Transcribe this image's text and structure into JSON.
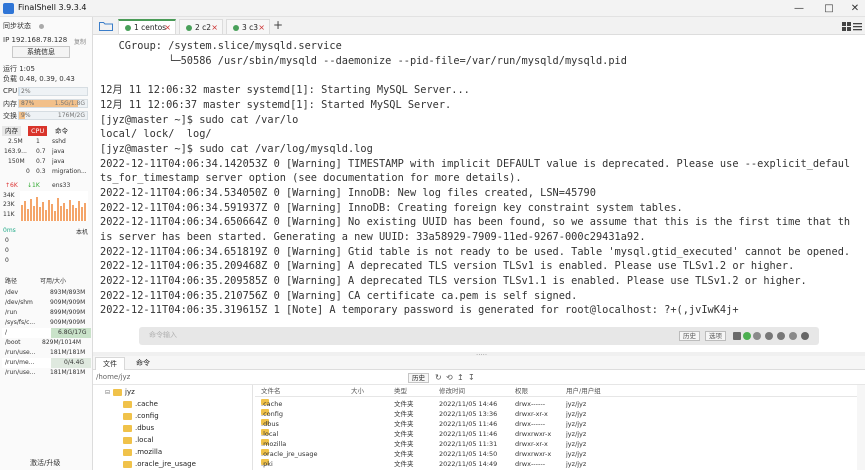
{
  "window": {
    "title": "FinalShell 3.9.3.4",
    "minimize": "—",
    "maximize": "□",
    "close": "✕"
  },
  "sidebar": {
    "sync_status": "同步状态",
    "ip": "IP 192.168.78.128",
    "copy": "复制",
    "sysinfo_button": "系统信息",
    "uptime": "运行 1:05",
    "load": "负载 0.48, 0.39, 0.43",
    "cpu_label": "CPU",
    "cpu_value": "2%",
    "cpu_percent": 2,
    "mem_label": "内存",
    "mem_value": "87%",
    "mem_detail": "1.5G/1.8G",
    "mem_percent": 87,
    "swap_label": "交换",
    "swap_value": "9%",
    "swap_detail": "176M/2G",
    "swap_percent": 9,
    "proc_tabs": [
      "内存",
      "CPU",
      "命令"
    ],
    "processes": [
      {
        "mem": "2.5M",
        "cpu": "1",
        "cmd": "sshd"
      },
      {
        "mem": "163.9...",
        "cpu": "0.7",
        "cmd": "java"
      },
      {
        "mem": "150M",
        "cpu": "0.7",
        "cmd": "java"
      },
      {
        "mem": "0",
        "cpu": "0.3",
        "cmd": "migration..."
      }
    ],
    "net": {
      "up": "↑6K",
      "down": "↓1K",
      "iface": "ens33",
      "scale": [
        "34K",
        "23K",
        "11K"
      ]
    },
    "ping": {
      "label": "0ms",
      "target": "本机",
      "values": [
        "0",
        "0",
        "0"
      ]
    },
    "disk_headers": [
      "路径",
      "可用/大小"
    ],
    "disks": [
      {
        "path": "/dev",
        "size": "893M/893M"
      },
      {
        "path": "/dev/shm",
        "size": "909M/909M"
      },
      {
        "path": "/run",
        "size": "899M/909M"
      },
      {
        "path": "/sys/fs/c...",
        "size": "909M/909M"
      },
      {
        "path": "/",
        "size": "6.8G/17G"
      },
      {
        "path": "/boot",
        "size": "829M/1014M"
      },
      {
        "path": "/run/use...",
        "size": "181M/181M"
      },
      {
        "path": "/run/me...",
        "size": "0/4.4G"
      },
      {
        "path": "/run/use...",
        "size": "181M/181M"
      }
    ],
    "upgrade": "激活/升级"
  },
  "tabs": [
    {
      "label": "1 centos",
      "active": true
    },
    {
      "label": "2 c2",
      "active": false
    },
    {
      "label": "3 c3",
      "active": false
    }
  ],
  "terminal": {
    "lines": [
      "   CGroup: /system.slice/mysqld.service",
      "           └─50586 /usr/sbin/mysqld --daemonize --pid-file=/var/run/mysqld/mysqld.pid",
      "",
      "12月 11 12:06:32 master systemd[1]: Starting MySQL Server...",
      "12月 11 12:06:37 master systemd[1]: Started MySQL Server.",
      "[jyz@master ~]$ sudo cat /var/lo",
      "local/ lock/  log/",
      "[jyz@master ~]$ sudo cat /var/log/mysqld.log",
      "2022-12-11T04:06:34.142053Z 0 [Warning] TIMESTAMP with implicit DEFAULT value is deprecated. Please use --explicit_defaul",
      "ts_for_timestamp server option (see documentation for more details).",
      "2022-12-11T04:06:34.534050Z 0 [Warning] InnoDB: New log files created, LSN=45790",
      "2022-12-11T04:06:34.591937Z 0 [Warning] InnoDB: Creating foreign key constraint system tables.",
      "2022-12-11T04:06:34.650664Z 0 [Warning] No existing UUID has been found, so we assume that this is the first time that th",
      "is server has been started. Generating a new UUID: 33a58929-7909-11ed-9267-000c29431a92.",
      "2022-12-11T04:06:34.651819Z 0 [Warning] Gtid table is not ready to be used. Table 'mysql.gtid_executed' cannot be opened.",
      "2022-12-11T04:06:35.209468Z 0 [Warning] A deprecated TLS version TLSv1 is enabled. Please use TLSv1.2 or higher.",
      "2022-12-11T04:06:35.209585Z 0 [Warning] A deprecated TLS version TLSv1.1 is enabled. Please use TLSv1.2 or higher.",
      "2022-12-11T04:06:35.210756Z 0 [Warning] CA certificate ca.pem is self signed.",
      "2022-12-11T04:06:35.319615Z 1 [Note] A temporary password is generated for root@localhost: ?+(,jvIwK4j+"
    ],
    "cmd_placeholder": "命令输入",
    "history": "历史",
    "options": "选项"
  },
  "bottom": {
    "tabs": [
      "文件",
      "命令"
    ],
    "path": "/home/jyz",
    "history": "历史",
    "tree": [
      ".cache",
      ".config",
      ".dbus",
      ".local",
      ".mozilla",
      ".oracle_jre_usage"
    ],
    "tree_root": "jyz",
    "headers": [
      "文件名",
      "大小",
      "类型",
      "修改时间",
      "权限",
      "用户/用户组"
    ],
    "files": [
      {
        "name": ".cache",
        "size": "",
        "type": "文件夹",
        "mtime": "2022/11/05 14:46",
        "perm": "drwx------",
        "owner": "jyz/jyz"
      },
      {
        "name": ".config",
        "size": "",
        "type": "文件夹",
        "mtime": "2022/11/05 13:36",
        "perm": "drwxr-xr-x",
        "owner": "jyz/jyz"
      },
      {
        "name": ".dbus",
        "size": "",
        "type": "文件夹",
        "mtime": "2022/11/05 11:46",
        "perm": "drwx------",
        "owner": "jyz/jyz"
      },
      {
        "name": ".local",
        "size": "",
        "type": "文件夹",
        "mtime": "2022/11/05 11:46",
        "perm": "drwxrwxr-x",
        "owner": "jyz/jyz"
      },
      {
        "name": ".mozilla",
        "size": "",
        "type": "文件夹",
        "mtime": "2022/11/05 11:31",
        "perm": "drwxr-xr-x",
        "owner": "jyz/jyz"
      },
      {
        "name": ".oracle_jre_usage",
        "size": "",
        "type": "文件夹",
        "mtime": "2022/11/05 14:50",
        "perm": "drwxrwxr-x",
        "owner": "jyz/jyz"
      },
      {
        "name": ".pki",
        "size": "",
        "type": "文件夹",
        "mtime": "2022/11/05 14:49",
        "perm": "drwx------",
        "owner": "jyz/jyz"
      }
    ]
  },
  "colors": {
    "cpu": "#cfe4f5",
    "mem": "#f2c08a",
    "swap": "#f2c08a",
    "accent": "#4a9b57"
  }
}
